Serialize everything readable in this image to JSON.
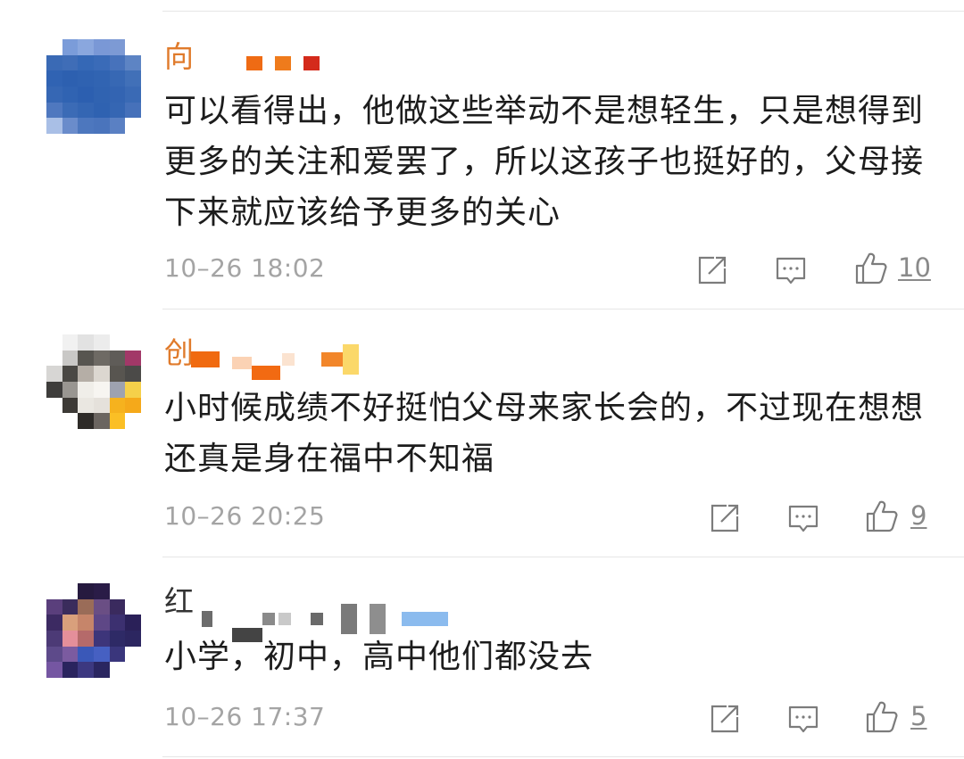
{
  "comments": [
    {
      "username": "向",
      "username_color": "#e07b2c",
      "text": "可以看得出，他做这些举动不是想轻生，只是想得到更多的关注和爱罢了，所以这孩子也挺好的，父母接下来就应该给予更多的关心",
      "time": "10–26 18:02",
      "likes": "10",
      "actions": [
        "share-icon",
        "comment-icon",
        "like-icon"
      ]
    },
    {
      "username": "创",
      "username_color": "#e07b2c",
      "text": "小时候成绩不好挺怕父母来家长会的，不过现在想想还真是身在福中不知福",
      "time": "10–26 20:25",
      "likes": "9",
      "actions": [
        "share-icon",
        "comment-icon",
        "like-icon"
      ]
    },
    {
      "username": "红",
      "username_color": "#333333",
      "text": "小学，初中，高中他们都没去",
      "time": "10–26 17:37",
      "likes": "5",
      "actions": [
        "share-icon",
        "comment-icon",
        "like-icon"
      ]
    }
  ],
  "colors": {
    "text": "#1c1c1c",
    "meta": "#a4a4a4",
    "divider": "#e6e6e6",
    "accent_username": "#e07b2c"
  }
}
